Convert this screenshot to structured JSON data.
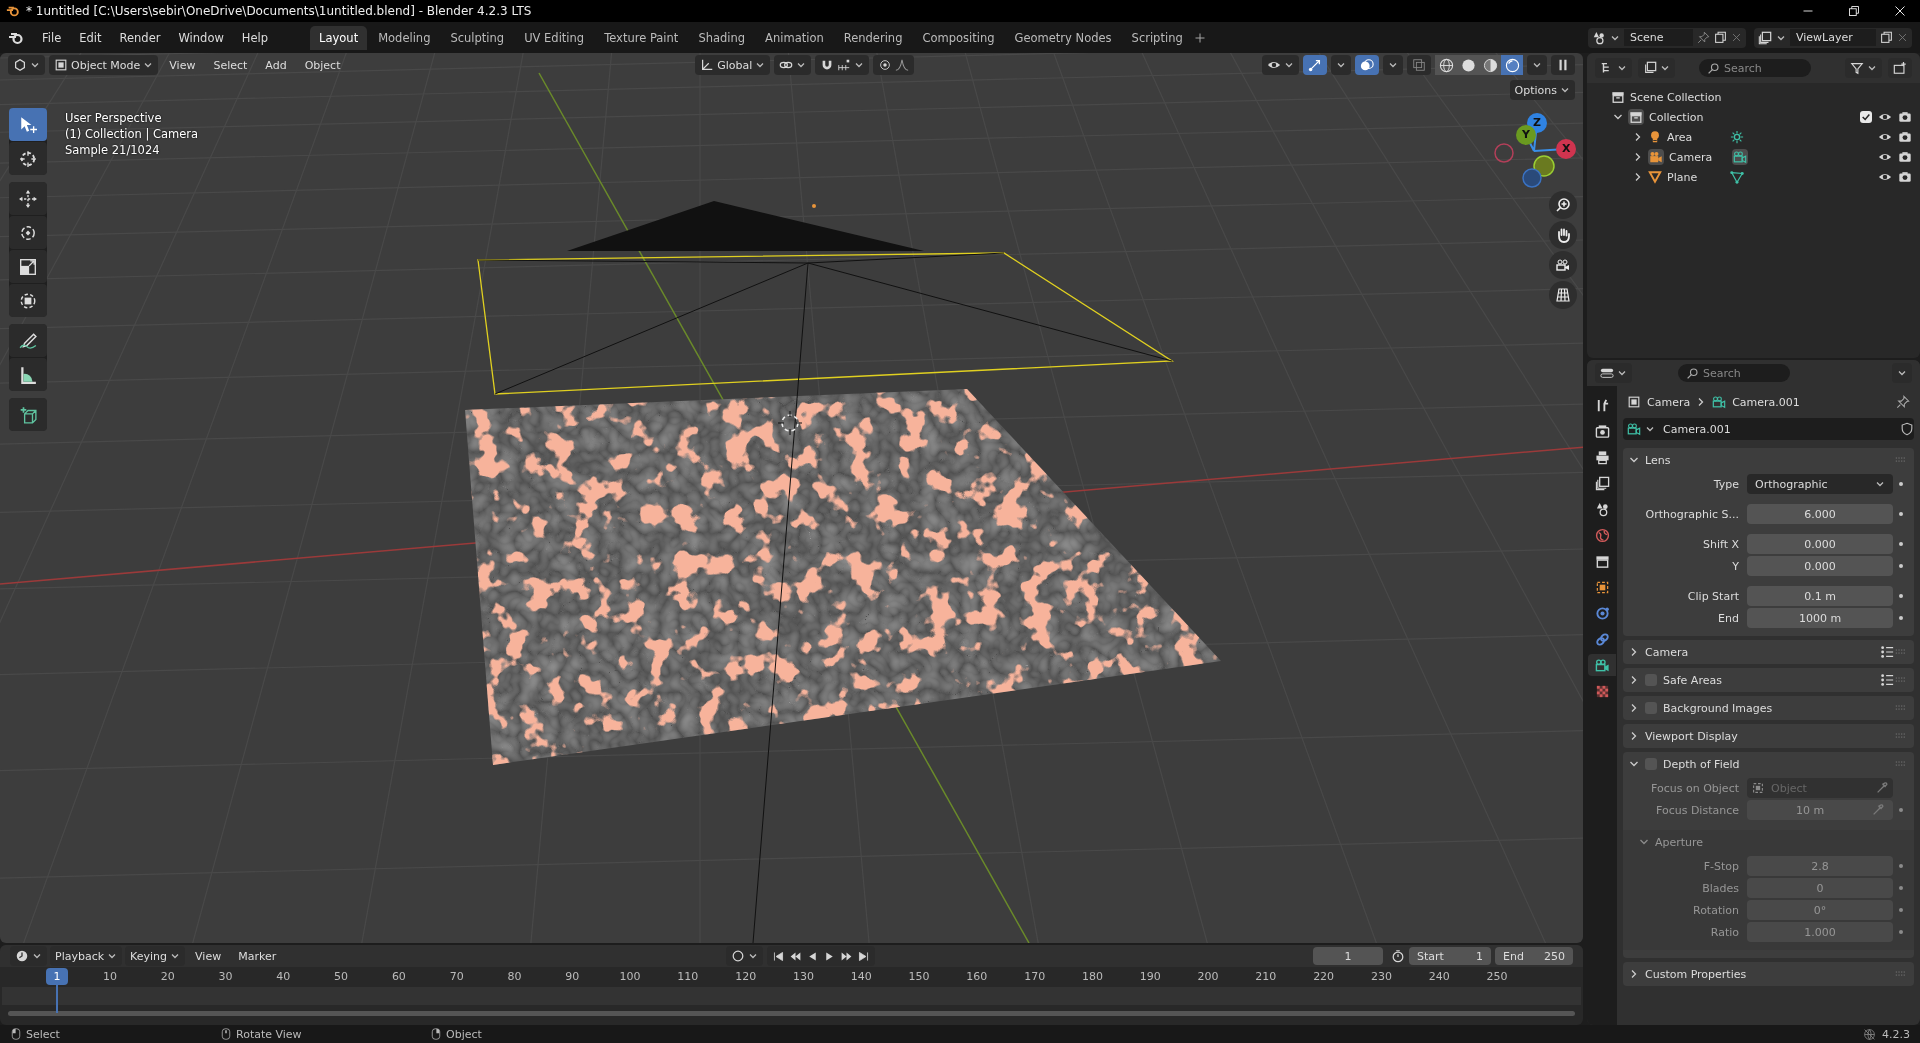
{
  "window": {
    "title": "* 1untitled [C:\\Users\\sebir\\OneDrive\\Documents\\1untitled.blend] - Blender 4.2.3 LTS"
  },
  "menu": [
    "File",
    "Edit",
    "Render",
    "Window",
    "Help"
  ],
  "workspaces": [
    {
      "label": "Layout",
      "selected": true
    },
    {
      "label": "Modeling",
      "selected": false
    },
    {
      "label": "Sculpting",
      "selected": false
    },
    {
      "label": "UV Editing",
      "selected": false
    },
    {
      "label": "Texture Paint",
      "selected": false
    },
    {
      "label": "Shading",
      "selected": false
    },
    {
      "label": "Animation",
      "selected": false
    },
    {
      "label": "Rendering",
      "selected": false
    },
    {
      "label": "Compositing",
      "selected": false
    },
    {
      "label": "Geometry Nodes",
      "selected": false
    },
    {
      "label": "Scripting",
      "selected": false
    }
  ],
  "scene": {
    "name": "Scene"
  },
  "view_layer": {
    "name": "ViewLayer"
  },
  "viewport": {
    "mode": "Object Mode",
    "menus": [
      "View",
      "Select",
      "Add",
      "Object"
    ],
    "orientation": "Global",
    "options": "Options",
    "shading": [
      {
        "kind": "wireframe",
        "selected": false
      },
      {
        "kind": "solid",
        "selected": false
      },
      {
        "kind": "material",
        "selected": false
      },
      {
        "kind": "rendered",
        "selected": true
      }
    ],
    "overlay_text": [
      "User Perspective",
      "(1) Collection | Camera",
      "Sample 21/1024"
    ],
    "tools": [
      [
        {
          "kind": "select",
          "selected": true
        },
        {
          "kind": "cursor",
          "selected": false
        }
      ],
      [
        {
          "kind": "move",
          "selected": false
        },
        {
          "kind": "rotate",
          "selected": false
        },
        {
          "kind": "scale",
          "selected": false
        },
        {
          "kind": "transform",
          "selected": false
        }
      ],
      [
        {
          "kind": "annotate",
          "selected": false
        },
        {
          "kind": "measure",
          "selected": false
        }
      ],
      [
        {
          "kind": "add-cube",
          "selected": false
        }
      ]
    ],
    "axes": [
      "Z",
      "Y",
      "X"
    ]
  },
  "outliner": {
    "search": {
      "placeholder": "Search"
    },
    "root": "Scene Collection",
    "collection": {
      "label": "Collection",
      "expanded": true,
      "checked": true,
      "children": [
        {
          "label": "Area",
          "kind": "light",
          "expanded": false,
          "active": false
        },
        {
          "label": "Camera",
          "kind": "camera",
          "expanded": false,
          "active": true
        },
        {
          "label": "Plane",
          "kind": "mesh",
          "expanded": false,
          "active": false
        }
      ]
    }
  },
  "properties": {
    "search": {
      "placeholder": "Search"
    },
    "tabs": [
      {
        "kind": "tool",
        "selected": false
      },
      {
        "kind": "render",
        "selected": false
      },
      {
        "kind": "output",
        "selected": false
      },
      {
        "kind": "view-layer",
        "selected": false
      },
      {
        "kind": "scene",
        "selected": false
      },
      {
        "kind": "world",
        "selected": false
      },
      {
        "kind": "collection",
        "selected": false
      },
      {
        "kind": "object",
        "selected": false
      },
      {
        "kind": "physics",
        "selected": false
      },
      {
        "kind": "constraints",
        "selected": false
      },
      {
        "kind": "camera-data",
        "selected": true
      },
      {
        "kind": "texture",
        "selected": false
      }
    ],
    "breadcrumb": [
      "Camera",
      "Camera.001"
    ],
    "datablock": "Camera.001",
    "panels": [
      {
        "title": "Lens",
        "expanded": true,
        "presets": false,
        "groups": [
          [
            {
              "kind": "dropdown",
              "label": "Type",
              "value": "Orthographic",
              "animatable": true
            }
          ],
          [
            {
              "kind": "number",
              "label": "Orthographic S...",
              "value": "6.000",
              "animatable": true
            }
          ],
          [
            {
              "kind": "number",
              "label": "Shift X",
              "value": "0.000",
              "animatable": true
            },
            {
              "kind": "number",
              "label": "Y",
              "value": "0.000",
              "animatable": true
            }
          ],
          [
            {
              "kind": "number",
              "label": "Clip Start",
              "value": "0.1 m",
              "animatable": true
            },
            {
              "kind": "number",
              "label": "End",
              "value": "1000 m",
              "animatable": true
            }
          ]
        ]
      },
      {
        "title": "Camera",
        "expanded": false,
        "presets": true
      },
      {
        "title": "Safe Areas",
        "expanded": false,
        "checked": false,
        "presets": true
      },
      {
        "title": "Background Images",
        "expanded": false,
        "checked": false,
        "presets": false
      },
      {
        "title": "Viewport Display",
        "expanded": false,
        "presets": false
      },
      {
        "title": "Depth of Field",
        "expanded": true,
        "checked": false,
        "presets": false,
        "disabled": true,
        "groups": [
          [
            {
              "kind": "object",
              "label": "Focus on Object",
              "placeholder": "Object",
              "animatable": false
            },
            {
              "kind": "number-picker",
              "label": "Focus Distance",
              "value": "10 m",
              "animatable": true
            }
          ]
        ],
        "subpanels": [
          {
            "title": "Aperture",
            "expanded": true,
            "groups": [
              [
                {
                  "kind": "number",
                  "label": "F-Stop",
                  "value": "2.8",
                  "animatable": true
                },
                {
                  "kind": "number",
                  "label": "Blades",
                  "value": "0",
                  "animatable": true
                },
                {
                  "kind": "number",
                  "label": "Rotation",
                  "value": "0°",
                  "animatable": true
                },
                {
                  "kind": "number",
                  "label": "Ratio",
                  "value": "1.000",
                  "animatable": true
                }
              ]
            ]
          }
        ]
      },
      {
        "title": "Custom Properties",
        "expanded": false,
        "presets": false
      }
    ]
  },
  "timeline": {
    "menus": [
      "Playback",
      "Keying",
      "View",
      "Marker"
    ],
    "current_frame": "1",
    "start": {
      "label": "Start",
      "value": "1"
    },
    "end": {
      "label": "End",
      "value": "250"
    },
    "playhead": "1",
    "ruler": [
      "10",
      "20",
      "30",
      "40",
      "50",
      "60",
      "70",
      "80",
      "90",
      "100",
      "110",
      "120",
      "130",
      "140",
      "150",
      "160",
      "170",
      "180",
      "190",
      "200",
      "210",
      "220",
      "230",
      "240",
      "250"
    ]
  },
  "status_bar": {
    "hints": [
      {
        "kind": "left-click",
        "label": "Select"
      },
      {
        "kind": "middle-click",
        "label": "Rotate View"
      },
      {
        "kind": "right-click",
        "label": "Object"
      }
    ],
    "version": "4.2.3"
  }
}
